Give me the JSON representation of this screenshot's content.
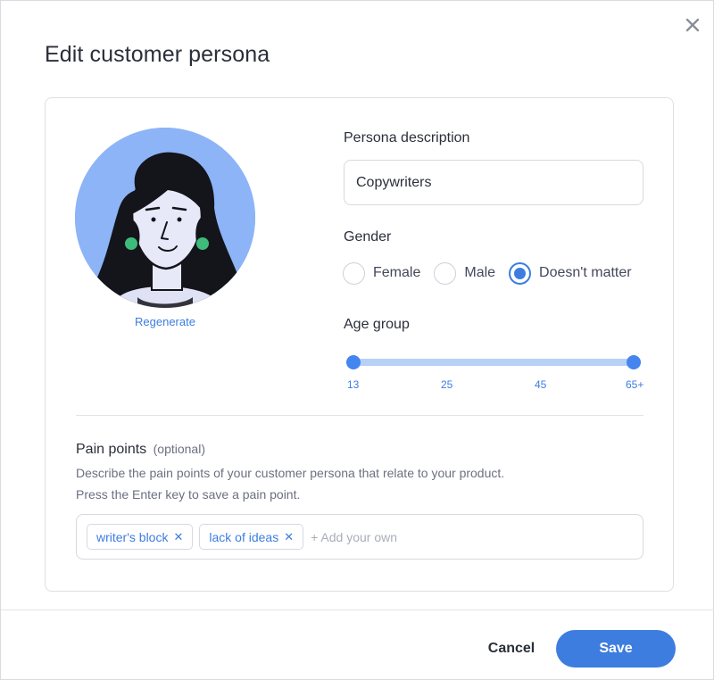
{
  "dialog": {
    "title": "Edit customer persona"
  },
  "icons": {
    "close": "close-icon",
    "tag_remove": "close-icon"
  },
  "avatar": {
    "regenerate_label": "Regenerate"
  },
  "persona_description": {
    "label": "Persona description",
    "value": "Copywriters"
  },
  "gender": {
    "label": "Gender",
    "options": [
      "Female",
      "Male",
      "Doesn't matter"
    ],
    "selected": "Doesn't matter"
  },
  "age_group": {
    "label": "Age group",
    "ticks": [
      "13",
      "25",
      "45",
      "65+"
    ],
    "range": [
      "13",
      "65+"
    ]
  },
  "pain_points": {
    "title": "Pain points",
    "optional": "(optional)",
    "help_line1": "Describe the pain points of your customer persona that relate to your product.",
    "help_line2": "Press the Enter key to save a pain point.",
    "tags": [
      "writer's block",
      "lack of ideas"
    ],
    "add_placeholder": "+ Add your own"
  },
  "footer": {
    "cancel_label": "Cancel",
    "save_label": "Save"
  },
  "colors": {
    "accent": "#3d7de0",
    "slider_track": "#b7d0f8",
    "avatar_bg": "#8db4f7",
    "earring": "#3dbb7a"
  }
}
